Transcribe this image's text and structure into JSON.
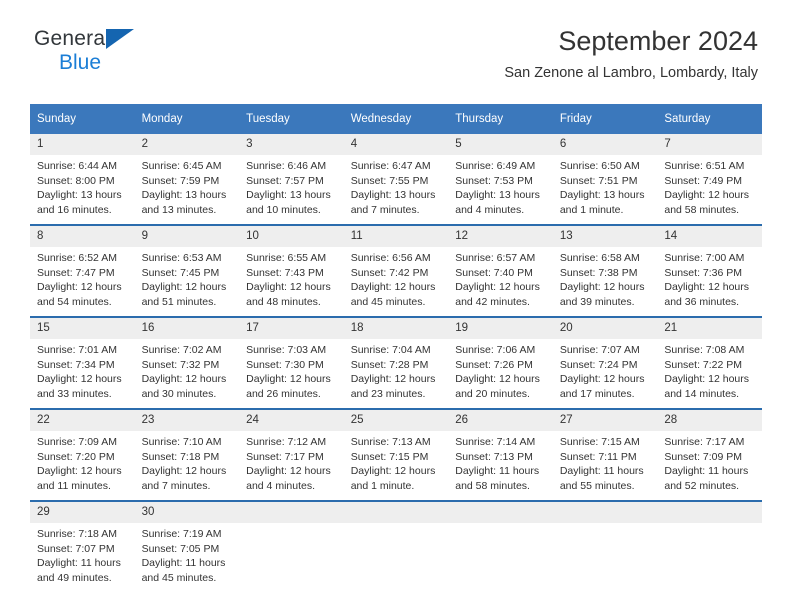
{
  "brand": {
    "name_part1": "General",
    "name_part2": "Blue",
    "triangle_color": "#1565b0",
    "blue_color": "#1b7ed6"
  },
  "header": {
    "title": "September 2024",
    "subtitle": "San Zenone al Lambro, Lombardy, Italy"
  },
  "theme": {
    "header_row_bg": "#3b78bc",
    "daynum_bg": "#eeeeee",
    "week_separator": "#2b6cad",
    "text": "#333333"
  },
  "weekdays": [
    "Sunday",
    "Monday",
    "Tuesday",
    "Wednesday",
    "Thursday",
    "Friday",
    "Saturday"
  ],
  "labels": {
    "sunrise_prefix": "Sunrise:",
    "sunset_prefix": "Sunset:",
    "daylight_prefix": "Daylight:"
  },
  "weeks": [
    [
      {
        "day": "1",
        "sunrise": "Sunrise: 6:44 AM",
        "sunset": "Sunset: 8:00 PM",
        "daylight1": "Daylight: 13 hours",
        "daylight2": "and 16 minutes."
      },
      {
        "day": "2",
        "sunrise": "Sunrise: 6:45 AM",
        "sunset": "Sunset: 7:59 PM",
        "daylight1": "Daylight: 13 hours",
        "daylight2": "and 13 minutes."
      },
      {
        "day": "3",
        "sunrise": "Sunrise: 6:46 AM",
        "sunset": "Sunset: 7:57 PM",
        "daylight1": "Daylight: 13 hours",
        "daylight2": "and 10 minutes."
      },
      {
        "day": "4",
        "sunrise": "Sunrise: 6:47 AM",
        "sunset": "Sunset: 7:55 PM",
        "daylight1": "Daylight: 13 hours",
        "daylight2": "and 7 minutes."
      },
      {
        "day": "5",
        "sunrise": "Sunrise: 6:49 AM",
        "sunset": "Sunset: 7:53 PM",
        "daylight1": "Daylight: 13 hours",
        "daylight2": "and 4 minutes."
      },
      {
        "day": "6",
        "sunrise": "Sunrise: 6:50 AM",
        "sunset": "Sunset: 7:51 PM",
        "daylight1": "Daylight: 13 hours",
        "daylight2": "and 1 minute."
      },
      {
        "day": "7",
        "sunrise": "Sunrise: 6:51 AM",
        "sunset": "Sunset: 7:49 PM",
        "daylight1": "Daylight: 12 hours",
        "daylight2": "and 58 minutes."
      }
    ],
    [
      {
        "day": "8",
        "sunrise": "Sunrise: 6:52 AM",
        "sunset": "Sunset: 7:47 PM",
        "daylight1": "Daylight: 12 hours",
        "daylight2": "and 54 minutes."
      },
      {
        "day": "9",
        "sunrise": "Sunrise: 6:53 AM",
        "sunset": "Sunset: 7:45 PM",
        "daylight1": "Daylight: 12 hours",
        "daylight2": "and 51 minutes."
      },
      {
        "day": "10",
        "sunrise": "Sunrise: 6:55 AM",
        "sunset": "Sunset: 7:43 PM",
        "daylight1": "Daylight: 12 hours",
        "daylight2": "and 48 minutes."
      },
      {
        "day": "11",
        "sunrise": "Sunrise: 6:56 AM",
        "sunset": "Sunset: 7:42 PM",
        "daylight1": "Daylight: 12 hours",
        "daylight2": "and 45 minutes."
      },
      {
        "day": "12",
        "sunrise": "Sunrise: 6:57 AM",
        "sunset": "Sunset: 7:40 PM",
        "daylight1": "Daylight: 12 hours",
        "daylight2": "and 42 minutes."
      },
      {
        "day": "13",
        "sunrise": "Sunrise: 6:58 AM",
        "sunset": "Sunset: 7:38 PM",
        "daylight1": "Daylight: 12 hours",
        "daylight2": "and 39 minutes."
      },
      {
        "day": "14",
        "sunrise": "Sunrise: 7:00 AM",
        "sunset": "Sunset: 7:36 PM",
        "daylight1": "Daylight: 12 hours",
        "daylight2": "and 36 minutes."
      }
    ],
    [
      {
        "day": "15",
        "sunrise": "Sunrise: 7:01 AM",
        "sunset": "Sunset: 7:34 PM",
        "daylight1": "Daylight: 12 hours",
        "daylight2": "and 33 minutes."
      },
      {
        "day": "16",
        "sunrise": "Sunrise: 7:02 AM",
        "sunset": "Sunset: 7:32 PM",
        "daylight1": "Daylight: 12 hours",
        "daylight2": "and 30 minutes."
      },
      {
        "day": "17",
        "sunrise": "Sunrise: 7:03 AM",
        "sunset": "Sunset: 7:30 PM",
        "daylight1": "Daylight: 12 hours",
        "daylight2": "and 26 minutes."
      },
      {
        "day": "18",
        "sunrise": "Sunrise: 7:04 AM",
        "sunset": "Sunset: 7:28 PM",
        "daylight1": "Daylight: 12 hours",
        "daylight2": "and 23 minutes."
      },
      {
        "day": "19",
        "sunrise": "Sunrise: 7:06 AM",
        "sunset": "Sunset: 7:26 PM",
        "daylight1": "Daylight: 12 hours",
        "daylight2": "and 20 minutes."
      },
      {
        "day": "20",
        "sunrise": "Sunrise: 7:07 AM",
        "sunset": "Sunset: 7:24 PM",
        "daylight1": "Daylight: 12 hours",
        "daylight2": "and 17 minutes."
      },
      {
        "day": "21",
        "sunrise": "Sunrise: 7:08 AM",
        "sunset": "Sunset: 7:22 PM",
        "daylight1": "Daylight: 12 hours",
        "daylight2": "and 14 minutes."
      }
    ],
    [
      {
        "day": "22",
        "sunrise": "Sunrise: 7:09 AM",
        "sunset": "Sunset: 7:20 PM",
        "daylight1": "Daylight: 12 hours",
        "daylight2": "and 11 minutes."
      },
      {
        "day": "23",
        "sunrise": "Sunrise: 7:10 AM",
        "sunset": "Sunset: 7:18 PM",
        "daylight1": "Daylight: 12 hours",
        "daylight2": "and 7 minutes."
      },
      {
        "day": "24",
        "sunrise": "Sunrise: 7:12 AM",
        "sunset": "Sunset: 7:17 PM",
        "daylight1": "Daylight: 12 hours",
        "daylight2": "and 4 minutes."
      },
      {
        "day": "25",
        "sunrise": "Sunrise: 7:13 AM",
        "sunset": "Sunset: 7:15 PM",
        "daylight1": "Daylight: 12 hours",
        "daylight2": "and 1 minute."
      },
      {
        "day": "26",
        "sunrise": "Sunrise: 7:14 AM",
        "sunset": "Sunset: 7:13 PM",
        "daylight1": "Daylight: 11 hours",
        "daylight2": "and 58 minutes."
      },
      {
        "day": "27",
        "sunrise": "Sunrise: 7:15 AM",
        "sunset": "Sunset: 7:11 PM",
        "daylight1": "Daylight: 11 hours",
        "daylight2": "and 55 minutes."
      },
      {
        "day": "28",
        "sunrise": "Sunrise: 7:17 AM",
        "sunset": "Sunset: 7:09 PM",
        "daylight1": "Daylight: 11 hours",
        "daylight2": "and 52 minutes."
      }
    ],
    [
      {
        "day": "29",
        "sunrise": "Sunrise: 7:18 AM",
        "sunset": "Sunset: 7:07 PM",
        "daylight1": "Daylight: 11 hours",
        "daylight2": "and 49 minutes."
      },
      {
        "day": "30",
        "sunrise": "Sunrise: 7:19 AM",
        "sunset": "Sunset: 7:05 PM",
        "daylight1": "Daylight: 11 hours",
        "daylight2": "and 45 minutes."
      },
      {
        "day": "",
        "sunrise": "",
        "sunset": "",
        "daylight1": "",
        "daylight2": ""
      },
      {
        "day": "",
        "sunrise": "",
        "sunset": "",
        "daylight1": "",
        "daylight2": ""
      },
      {
        "day": "",
        "sunrise": "",
        "sunset": "",
        "daylight1": "",
        "daylight2": ""
      },
      {
        "day": "",
        "sunrise": "",
        "sunset": "",
        "daylight1": "",
        "daylight2": ""
      },
      {
        "day": "",
        "sunrise": "",
        "sunset": "",
        "daylight1": "",
        "daylight2": ""
      }
    ]
  ]
}
